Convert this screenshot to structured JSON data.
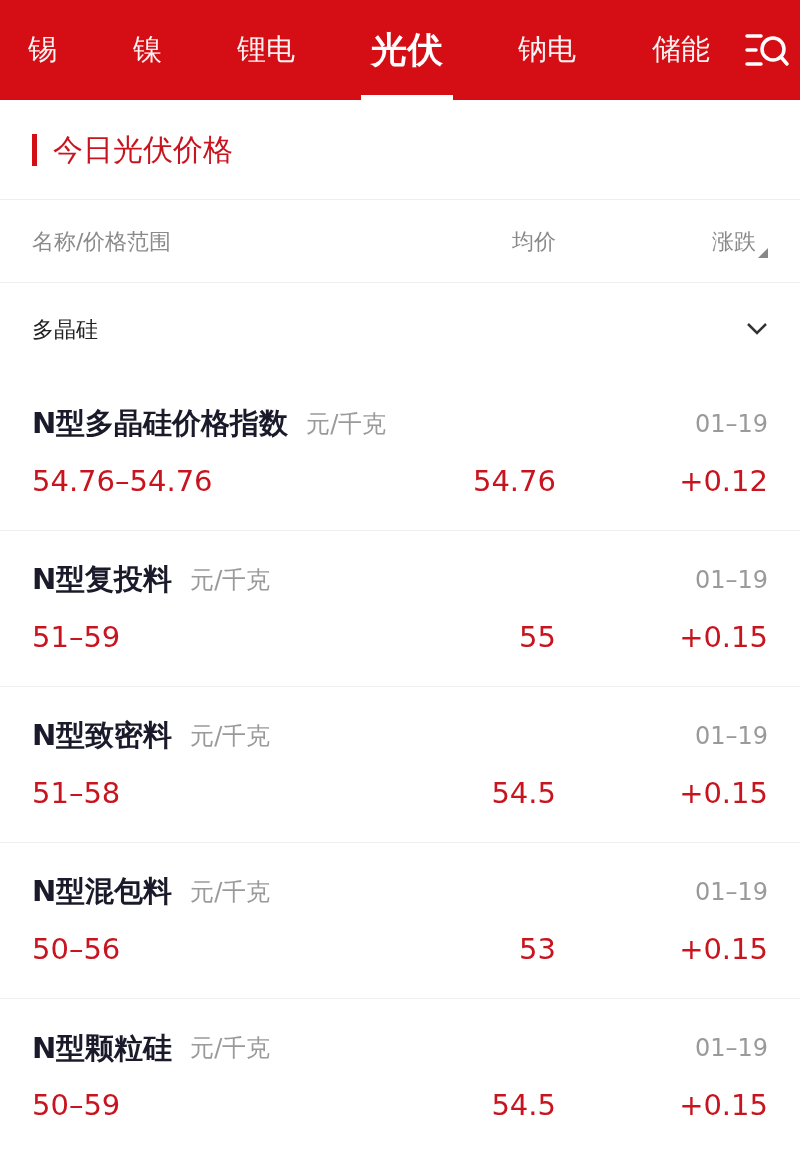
{
  "tabs": [
    {
      "label": "锡",
      "selected": false
    },
    {
      "label": "镍",
      "selected": false
    },
    {
      "label": "锂电",
      "selected": false
    },
    {
      "label": "光伏",
      "selected": true
    },
    {
      "label": "钠电",
      "selected": false
    },
    {
      "label": "储能",
      "selected": false
    }
  ],
  "section_title": "今日光伏价格",
  "columns": [
    "名称/价格范围",
    "均价",
    "涨跌"
  ],
  "category": {
    "label": "多晶硅",
    "expanded": true
  },
  "items": [
    {
      "name": "N型多晶硅价格指数",
      "unit": "元/千克",
      "date": "01–19",
      "range": "54.76–54.76",
      "average": "54.76",
      "change": "+0.12"
    },
    {
      "name": "N型复投料",
      "unit": "元/千克",
      "date": "01–19",
      "range": "51–59",
      "average": "55",
      "change": "+0.15"
    },
    {
      "name": "N型致密料",
      "unit": "元/千克",
      "date": "01–19",
      "range": "51–58",
      "average": "54.5",
      "change": "+0.15"
    },
    {
      "name": "N型混包料",
      "unit": "元/千克",
      "date": "01–19",
      "range": "50–56",
      "average": "53",
      "change": "+0.15"
    },
    {
      "name": "N型颗粒硅",
      "unit": "元/千克",
      "date": "01–19",
      "range": "50–59",
      "average": "54.5",
      "change": "+0.15"
    }
  ]
}
